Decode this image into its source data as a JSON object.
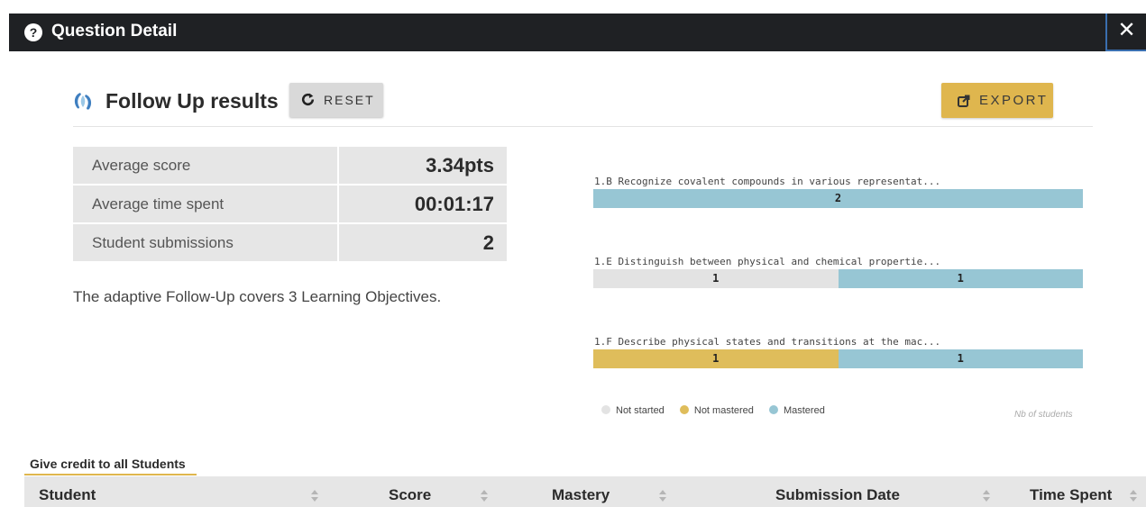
{
  "dialog": {
    "title": "Question Detail",
    "help_icon": "?",
    "close_icon": "✕"
  },
  "header": {
    "title": "Follow Up results",
    "logo_icon": "adaptive-logo-icon",
    "reset_label": "RESET",
    "reset_icon": "refresh-icon",
    "export_label": "EXPORT",
    "export_icon": "external-link-icon",
    "export_color": "#dfb64e"
  },
  "stats": [
    {
      "label": "Average score",
      "value": "3.34pts"
    },
    {
      "label": "Average time spent",
      "value": "00:01:17"
    },
    {
      "label": "Student submissions",
      "value": "2"
    }
  ],
  "description": "The adaptive Follow-Up covers 3 Learning Objectives.",
  "chart_data": {
    "type": "bar",
    "orientation": "horizontal-stacked",
    "categories": [
      "1.B Recognize covalent compounds in various representat...",
      "1.E Distinguish between physical and chemical propertie...",
      "1.F Describe physical states and transitions at the mac..."
    ],
    "series": [
      {
        "name": "Not started",
        "color": "#e3e3e3",
        "values": [
          0,
          1,
          0
        ]
      },
      {
        "name": "Not mastered",
        "color": "#dfbd5b",
        "values": [
          0,
          0,
          1
        ]
      },
      {
        "name": "Mastered",
        "color": "#97c6d4",
        "values": [
          2,
          1,
          1
        ]
      }
    ],
    "legend_position": "bottom-left",
    "axis_note": "Nb of students"
  },
  "credit_link": "Give credit to all Students",
  "table": {
    "columns": [
      "Student",
      "Score",
      "Mastery",
      "Submission Date",
      "Time Spent"
    ],
    "sort_icon": "sort-arrows-icon"
  }
}
